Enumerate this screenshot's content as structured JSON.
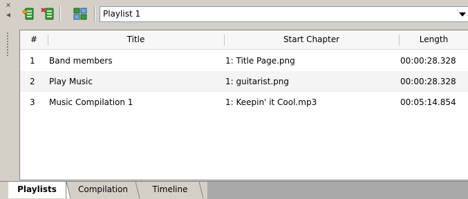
{
  "toolbar": {
    "playlist_selected": "Playlist 1"
  },
  "table": {
    "headers": [
      "#",
      "Title",
      "Start Chapter",
      "Length"
    ],
    "rows": [
      {
        "num": "1",
        "title": "Band members",
        "start": "1: Title Page.png",
        "length": "00:00:28.328"
      },
      {
        "num": "2",
        "title": "Play Music",
        "start": "1: guitarist.png",
        "length": "00:00:28.328"
      },
      {
        "num": "3",
        "title": "Music Compilation 1",
        "start": "1: Keepin' it Cool.mp3",
        "length": "00:05:14.854"
      }
    ]
  },
  "tabs": [
    {
      "label": "Playlists",
      "active": true
    },
    {
      "label": "Compilation",
      "active": false
    },
    {
      "label": "Timeline",
      "active": false
    }
  ],
  "icons": {
    "close": "close-icon",
    "pin": "pin-icon",
    "add_playlist": "add-playlist-icon",
    "remove_playlist": "remove-playlist-icon",
    "playlist_properties": "playlist-properties-icon"
  },
  "colors": {
    "panel": "#d4d0c8",
    "list_bg": "#ffffff",
    "alt_row": "#f4f4f4",
    "tab_strip": "#a8a8a8"
  }
}
